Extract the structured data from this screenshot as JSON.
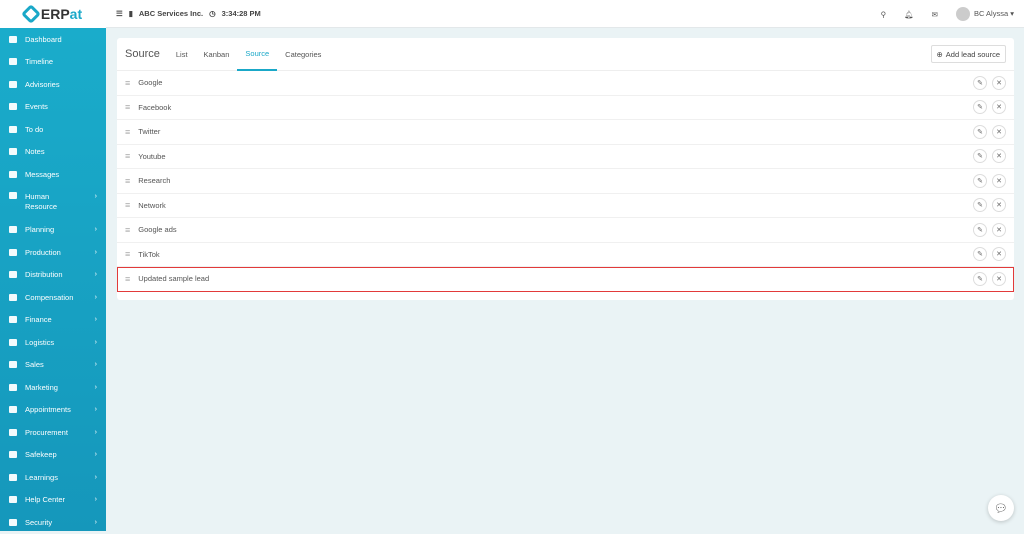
{
  "logo": {
    "text": "ERP",
    "accent": "at"
  },
  "topbar": {
    "company": "ABC Services Inc.",
    "time": "3:34:28 PM",
    "user": "BC Alyssa"
  },
  "sidebar": [
    {
      "label": "Dashboard"
    },
    {
      "label": "Timeline"
    },
    {
      "label": "Advisories"
    },
    {
      "label": "Events"
    },
    {
      "label": "To do"
    },
    {
      "label": "Notes"
    },
    {
      "label": "Messages"
    },
    {
      "label": "Human Resource",
      "sub": true
    },
    {
      "label": "Planning",
      "sub": true
    },
    {
      "label": "Production",
      "sub": true
    },
    {
      "label": "Distribution",
      "sub": true
    },
    {
      "label": "Compensation",
      "sub": true
    },
    {
      "label": "Finance",
      "sub": true
    },
    {
      "label": "Logistics",
      "sub": true
    },
    {
      "label": "Sales",
      "sub": true
    },
    {
      "label": "Marketing",
      "sub": true
    },
    {
      "label": "Appointments",
      "sub": true
    },
    {
      "label": "Procurement",
      "sub": true
    },
    {
      "label": "Safekeep",
      "sub": true
    },
    {
      "label": "Learnings",
      "sub": true
    },
    {
      "label": "Help Center",
      "sub": true
    },
    {
      "label": "Security",
      "sub": true
    }
  ],
  "panel": {
    "title": "Source",
    "tabs": [
      "List",
      "Kanban",
      "Source",
      "Categories"
    ],
    "active_tab": "Source",
    "add_label": "Add lead source",
    "rows": [
      "Google",
      "Facebook",
      "Twitter",
      "Youtube",
      "Research",
      "Network",
      "Google ads",
      "TikTok",
      "Updated sample lead"
    ],
    "highlighted": "Updated sample lead"
  },
  "colors": {
    "accent": "#1aa8c8",
    "highlight": "#e23a3a"
  }
}
